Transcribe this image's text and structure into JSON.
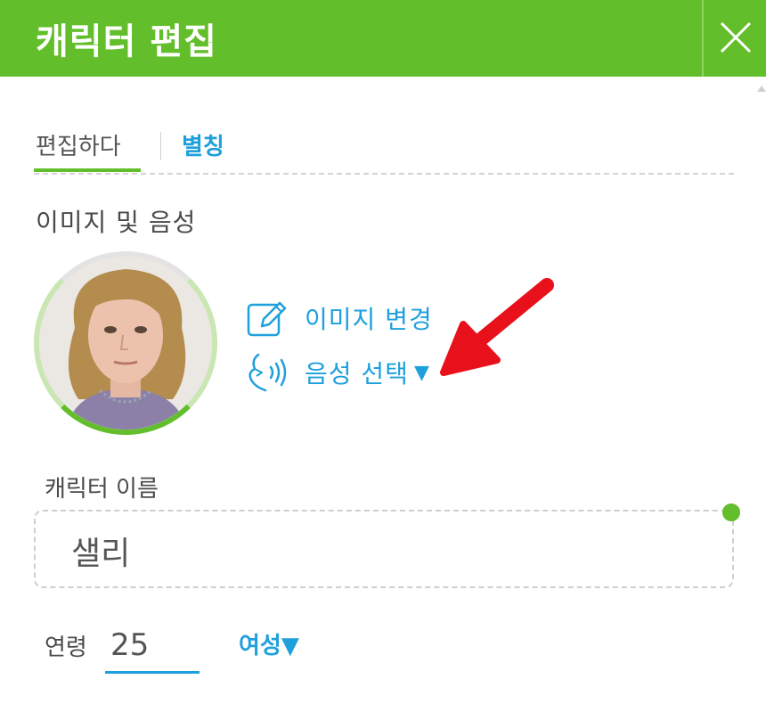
{
  "dialog": {
    "title": "캐릭터 편집"
  },
  "tabs": [
    {
      "label": "편집하다",
      "active": true
    },
    {
      "label": "별칭",
      "active": false
    }
  ],
  "image_voice": {
    "section_title": "이미지 및 음성",
    "change_image_label": "이미지 변경",
    "select_voice_label": "음성 선택"
  },
  "name": {
    "label": "캐릭터 이름",
    "value": "샐리"
  },
  "age": {
    "label": "연령",
    "value": "25"
  },
  "gender": {
    "label": "여성"
  },
  "icons": {
    "close": "close-icon",
    "edit": "edit-pencil-icon",
    "voice": "voice-speaking-icon",
    "dropdown": "caret-down-icon"
  },
  "colors": {
    "accent_green": "#62be2a",
    "accent_blue": "#1ea0dc",
    "annotation_red": "#e8101a"
  }
}
